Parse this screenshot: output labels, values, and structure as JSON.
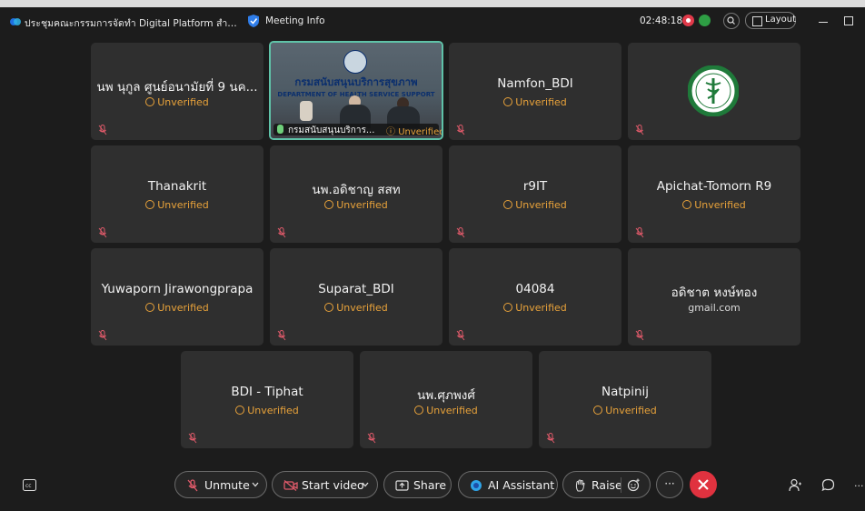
{
  "window": {
    "title": "ประชุมคณะกรรมการจัดทำ Digital Platform สำหรับโครงการ...",
    "meeting_info": "Meeting Info",
    "clock": "02:48:18",
    "layout_label": "Layout"
  },
  "participants": [
    {
      "name": "นพ นุกูล ศูนย์อนามัยที่ 9 นค...",
      "status": "Unverified"
    },
    {
      "name": "กรมสนับสนุนบริการ...",
      "status": "Unverified",
      "video": true,
      "banner_th": "กรมสนับสนุนบริการสุขภาพ",
      "banner_en": "DEPARTMENT OF HEALTH SERVICE SUPPORT"
    },
    {
      "name": "Namfon_BDI",
      "status": "Unverified"
    },
    {
      "name": "",
      "status": "",
      "logo": "ministry-of-public-health-logo"
    },
    {
      "name": "Thanakrit",
      "status": "Unverified"
    },
    {
      "name": "นพ.อดิชาญ สสท",
      "status": "Unverified"
    },
    {
      "name": "r9IT",
      "status": "Unverified"
    },
    {
      "name": "Apichat-Tomorn R9",
      "status": "Unverified"
    },
    {
      "name": "Yuwaporn Jirawongprapa",
      "status": "Unverified"
    },
    {
      "name": "Suparat_BDI",
      "status": "Unverified"
    },
    {
      "name": "04084",
      "status": "Unverified"
    },
    {
      "name": "อดิชาต หงษ์ทอง",
      "status": "gmail.com"
    },
    {
      "name": "BDI - Tiphat",
      "status": "Unverified"
    },
    {
      "name": "นพ.ศุภพงศ์",
      "status": "Unverified"
    },
    {
      "name": "Natpinij",
      "status": "Unverified"
    }
  ],
  "toolbar": {
    "unmute": "Unmute",
    "start_video": "Start video",
    "share": "Share",
    "ai_assistant": "AI Assistant",
    "raise": "Raise",
    "more": "···"
  },
  "colors": {
    "unverified": "#e8a23a",
    "end_call": "#e0323f",
    "active_speaker_border": "#5fc2a8"
  }
}
